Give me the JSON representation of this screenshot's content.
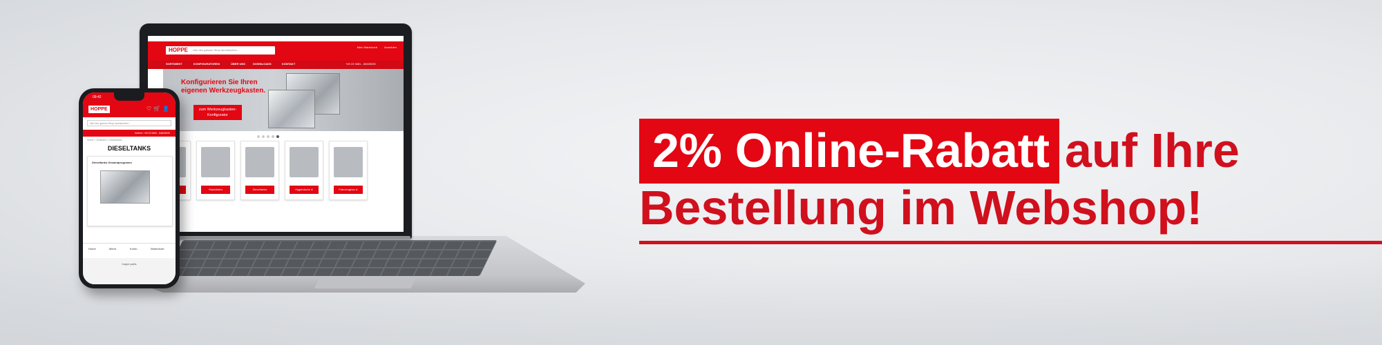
{
  "promo": {
    "highlight": "2% Online-Rabatt",
    "rest": "auf Ihre",
    "line2": "Bestellung im Webshop!",
    "accent_color": "#e30613",
    "text_color": "#d0101d"
  },
  "laptop_site": {
    "logo": "HOPPE",
    "search_placeholder": "Hier den ganzen Shop durchsuchen...",
    "header_icons": [
      "Mein Warenkorb",
      "Anmelden"
    ],
    "nav": [
      "SORTIMENT",
      "KONFIGURATOREN",
      "ÜBER UNS",
      "DOWNLOADS",
      "KONTAKT"
    ],
    "hotline": "+49 22 5481 - 84626030",
    "hero_title": "Konfigurieren Sie Ihren eigenen Werkzeugkasten.",
    "hero_button": "zum Werkzeugkasten-Konfigurator",
    "categories": [
      "Hydraulik",
      "Staukästen",
      "Dieseltanks",
      "Hygienische & Fahrzeugteile",
      "Fahrzeugbau & Werkstattbedarf"
    ]
  },
  "phone_site": {
    "time": "09:42",
    "logo": "HOPPE",
    "search_placeholder": "Hier den ganzen Shop durchsuchen...",
    "hotline": "Hotline: +49 22 5481 - 84626030",
    "breadcrumb": "Home  >  Sortiment  >  Dieseltanks",
    "page_title": "DIESELTANKS",
    "card_title": "Dieseltanks Gesamtprogramm",
    "tabs": [
      "Home",
      "Menü",
      "Konto",
      "Warenkorb"
    ],
    "url": "hoppe.parts"
  }
}
